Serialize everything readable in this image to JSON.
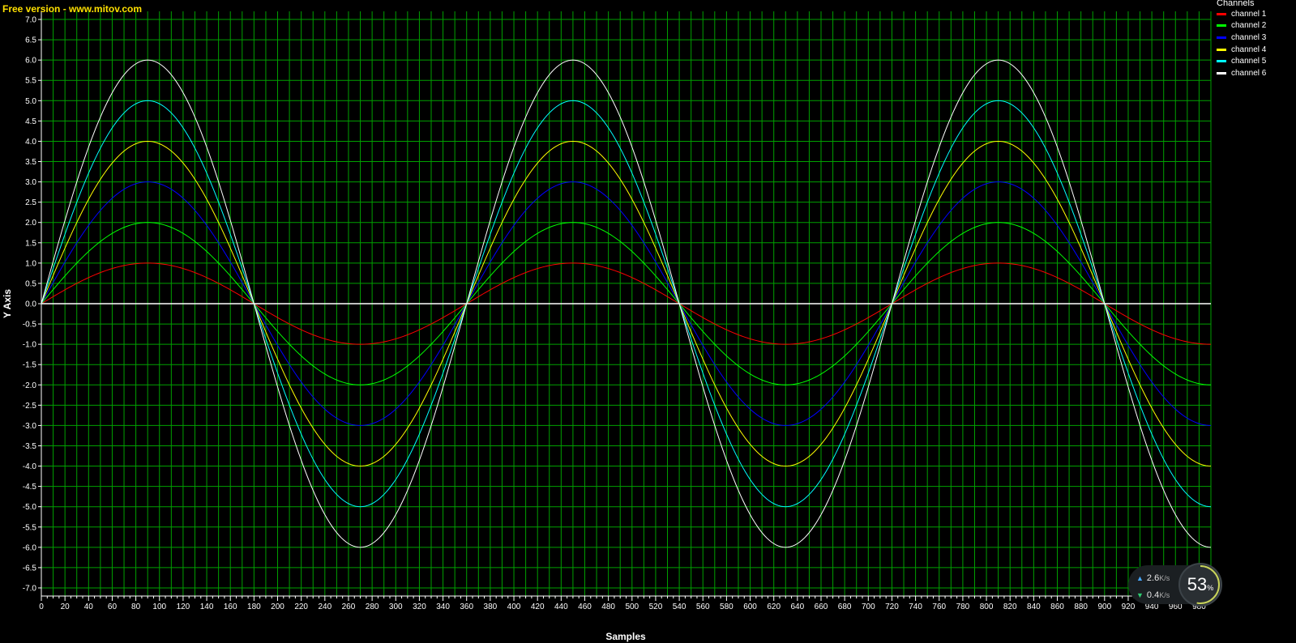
{
  "watermark": "Free version - www.mitov.com",
  "legend": {
    "title": "Channels",
    "items": [
      {
        "label": "channel 1",
        "color": "#ff0000"
      },
      {
        "label": "channel 2",
        "color": "#00ff00"
      },
      {
        "label": "channel 3",
        "color": "#0000ff"
      },
      {
        "label": "channel 4",
        "color": "#ffff00"
      },
      {
        "label": "channel 5",
        "color": "#00ffff"
      },
      {
        "label": "channel 6",
        "color": "#ffffff"
      }
    ]
  },
  "chart_data": {
    "type": "line",
    "title": "",
    "xlabel": "Samples",
    "ylabel": "Y Axis",
    "xlim": [
      0,
      990
    ],
    "ylim": [
      -7.2,
      7.2
    ],
    "x_ticks": [
      0,
      20,
      40,
      60,
      80,
      100,
      120,
      140,
      160,
      180,
      200,
      220,
      240,
      260,
      280,
      300,
      320,
      340,
      360,
      380,
      400,
      420,
      440,
      460,
      480,
      500,
      520,
      540,
      560,
      580,
      600,
      620,
      640,
      660,
      680,
      700,
      720,
      740,
      760,
      780,
      800,
      820,
      840,
      860,
      880,
      900,
      920,
      940,
      960,
      980
    ],
    "y_ticks": [
      "7.0",
      "6.5",
      "6.0",
      "5.5",
      "5.0",
      "4.5",
      "4.0",
      "3.5",
      "3.0",
      "2.5",
      "2.0",
      "1.5",
      "1.0",
      "0.5",
      "0.0",
      "-0.5",
      "-1.0",
      "-1.5",
      "-2.0",
      "-2.5",
      "-3.0",
      "-3.5",
      "-4.0",
      "-4.5",
      "-5.0",
      "-5.5",
      "-6.0",
      "-6.5",
      "-7.0"
    ],
    "grid": true,
    "background": "#000000",
    "grid_color": "#00a000",
    "legend_position": "top-right",
    "x_samples": [
      0,
      10,
      20,
      30,
      40,
      50,
      60,
      70,
      80,
      90,
      100,
      110,
      120,
      130,
      140,
      150,
      160,
      170,
      180,
      190,
      200,
      210,
      220,
      230,
      240,
      250,
      260,
      270,
      280,
      290,
      300,
      310,
      320,
      330,
      340,
      350,
      360,
      370,
      380,
      390,
      400,
      410,
      420,
      430,
      440,
      450,
      460,
      470,
      480,
      490,
      500,
      510,
      520,
      530,
      540,
      550,
      560,
      570,
      580,
      590,
      600,
      610,
      620,
      630,
      640,
      650,
      660,
      670,
      680,
      690,
      700,
      710,
      720,
      730,
      740,
      750,
      760,
      770,
      780,
      790,
      800,
      810,
      820,
      830,
      840,
      850,
      860,
      870,
      880,
      890,
      900,
      910,
      920,
      930,
      940,
      950,
      960,
      970,
      980,
      990
    ],
    "series": [
      {
        "name": "channel 1",
        "color": "#ff0000",
        "amplitude": 1,
        "values": [
          0,
          0.17,
          0.34,
          0.5,
          0.64,
          0.77,
          0.87,
          0.94,
          0.98,
          1,
          0.98,
          0.94,
          0.87,
          0.77,
          0.64,
          0.5,
          0.34,
          0.17,
          0,
          -0.17,
          -0.34,
          -0.5,
          -0.64,
          -0.77,
          -0.87,
          -0.94,
          -0.98,
          -1,
          -0.98,
          -0.94,
          -0.87,
          -0.77,
          -0.64,
          -0.5,
          -0.34,
          -0.17,
          0,
          0.17,
          0.34,
          0.5,
          0.64,
          0.77,
          0.87,
          0.94,
          0.98,
          1,
          0.98,
          0.94,
          0.87,
          0.77,
          0.64,
          0.5,
          0.34,
          0.17,
          0,
          -0.17,
          -0.34,
          -0.5,
          -0.64,
          -0.77,
          -0.87,
          -0.94,
          -0.98,
          -1,
          -0.98,
          -0.94,
          -0.87,
          -0.77,
          -0.64,
          -0.5,
          -0.34,
          -0.17,
          0,
          0.17,
          0.34,
          0.5,
          0.64,
          0.77,
          0.87,
          0.94,
          0.98,
          1,
          0.98,
          0.94,
          0.87,
          0.77,
          0.64,
          0.5,
          0.34,
          0.17,
          0,
          -0.17,
          -0.34,
          -0.5,
          -0.64,
          -0.77,
          -0.87,
          -0.94,
          -0.98,
          -1
        ]
      },
      {
        "name": "channel 2",
        "color": "#00ff00",
        "amplitude": 2,
        "values": [
          0,
          0.35,
          0.68,
          1,
          1.29,
          1.53,
          1.73,
          1.88,
          1.97,
          2,
          1.97,
          1.88,
          1.73,
          1.53,
          1.29,
          1,
          0.68,
          0.35,
          0,
          -0.35,
          -0.68,
          -1,
          -1.29,
          -1.53,
          -1.73,
          -1.88,
          -1.97,
          -2,
          -1.97,
          -1.88,
          -1.73,
          -1.53,
          -1.29,
          -1,
          -0.68,
          -0.35,
          0,
          0.35,
          0.68,
          1,
          1.29,
          1.53,
          1.73,
          1.88,
          1.97,
          2,
          1.97,
          1.88,
          1.73,
          1.53,
          1.29,
          1,
          0.68,
          0.35,
          0,
          -0.35,
          -0.68,
          -1,
          -1.29,
          -1.53,
          -1.73,
          -1.88,
          -1.97,
          -2,
          -1.97,
          -1.88,
          -1.73,
          -1.53,
          -1.29,
          -1,
          -0.68,
          -0.35,
          0,
          0.35,
          0.68,
          1,
          1.29,
          1.53,
          1.73,
          1.88,
          1.97,
          2,
          1.97,
          1.88,
          1.73,
          1.53,
          1.29,
          1,
          0.68,
          0.35,
          0,
          -0.35,
          -0.68,
          -1,
          -1.29,
          -1.53,
          -1.73,
          -1.88,
          -1.97,
          -2
        ]
      },
      {
        "name": "channel 3",
        "color": "#0000ff",
        "amplitude": 3,
        "values": [
          0,
          0.52,
          1.03,
          1.5,
          1.93,
          2.3,
          2.6,
          2.82,
          2.95,
          3,
          2.95,
          2.82,
          2.6,
          2.3,
          1.93,
          1.5,
          1.03,
          0.52,
          0,
          -0.52,
          -1.03,
          -1.5,
          -1.93,
          -2.3,
          -2.6,
          -2.82,
          -2.95,
          -3,
          -2.95,
          -2.82,
          -2.6,
          -2.3,
          -1.93,
          -1.5,
          -1.03,
          -0.52,
          0,
          0.52,
          1.03,
          1.5,
          1.93,
          2.3,
          2.6,
          2.82,
          2.95,
          3,
          2.95,
          2.82,
          2.6,
          2.3,
          1.93,
          1.5,
          1.03,
          0.52,
          0,
          -0.52,
          -1.03,
          -1.5,
          -1.93,
          -2.3,
          -2.6,
          -2.82,
          -2.95,
          -3,
          -2.95,
          -2.82,
          -2.6,
          -2.3,
          -1.93,
          -1.5,
          -1.03,
          -0.52,
          0,
          0.52,
          1.03,
          1.5,
          1.93,
          2.3,
          2.6,
          2.82,
          2.95,
          3,
          2.95,
          2.82,
          2.6,
          2.3,
          1.93,
          1.5,
          1.03,
          0.52,
          0,
          -0.52,
          -1.03,
          -1.5,
          -1.93,
          -2.3,
          -2.6,
          -2.82,
          -2.95,
          -3
        ]
      },
      {
        "name": "channel 4",
        "color": "#ffff00",
        "amplitude": 4,
        "values": [
          0,
          0.69,
          1.37,
          2,
          2.57,
          3.06,
          3.46,
          3.76,
          3.94,
          4,
          3.94,
          3.76,
          3.46,
          3.06,
          2.57,
          2,
          1.37,
          0.69,
          0,
          -0.69,
          -1.37,
          -2,
          -2.57,
          -3.06,
          -3.46,
          -3.76,
          -3.94,
          -4,
          -3.94,
          -3.76,
          -3.46,
          -3.06,
          -2.57,
          -2,
          -1.37,
          -0.69,
          0,
          0.69,
          1.37,
          2,
          2.57,
          3.06,
          3.46,
          3.76,
          3.94,
          4,
          3.94,
          3.76,
          3.46,
          3.06,
          2.57,
          2,
          1.37,
          0.69,
          0,
          -0.69,
          -1.37,
          -2,
          -2.57,
          -3.06,
          -3.46,
          -3.76,
          -3.94,
          -4,
          -3.94,
          -3.76,
          -3.46,
          -3.06,
          -2.57,
          -2,
          -1.37,
          -0.69,
          0,
          0.69,
          1.37,
          2,
          2.57,
          3.06,
          3.46,
          3.76,
          3.94,
          4,
          3.94,
          3.76,
          3.46,
          3.06,
          2.57,
          2,
          1.37,
          0.69,
          0,
          -0.69,
          -1.37,
          -2,
          -2.57,
          -3.06,
          -3.46,
          -3.76,
          -3.94,
          -4
        ]
      },
      {
        "name": "channel 5",
        "color": "#00ffff",
        "amplitude": 5,
        "values": [
          0,
          0.87,
          1.71,
          2.5,
          3.21,
          3.83,
          4.33,
          4.7,
          4.92,
          5,
          4.92,
          4.7,
          4.33,
          3.83,
          3.21,
          2.5,
          1.71,
          0.87,
          0,
          -0.87,
          -1.71,
          -2.5,
          -3.21,
          -3.83,
          -4.33,
          -4.7,
          -4.92,
          -5,
          -4.92,
          -4.7,
          -4.33,
          -3.83,
          -3.21,
          -2.5,
          -1.71,
          -0.87,
          0,
          0.87,
          1.71,
          2.5,
          3.21,
          3.83,
          4.33,
          4.7,
          4.92,
          5,
          4.92,
          4.7,
          4.33,
          3.83,
          3.21,
          2.5,
          1.71,
          0.87,
          0,
          -0.87,
          -1.71,
          -2.5,
          -3.21,
          -3.83,
          -4.33,
          -4.7,
          -4.92,
          -5,
          -4.92,
          -4.7,
          -4.33,
          -3.83,
          -3.21,
          -2.5,
          -1.71,
          -0.87,
          0,
          0.87,
          1.71,
          2.5,
          3.21,
          3.83,
          4.33,
          4.7,
          4.92,
          5,
          4.92,
          4.7,
          4.33,
          3.83,
          3.21,
          2.5,
          1.71,
          0.87,
          0,
          -0.87,
          -1.71,
          -2.5,
          -3.21,
          -3.83,
          -4.33,
          -4.7,
          -4.92,
          -5
        ]
      },
      {
        "name": "channel 6",
        "color": "#ffffff",
        "amplitude": 6,
        "values": [
          0,
          1.04,
          2.05,
          3,
          3.86,
          4.6,
          5.2,
          5.64,
          5.91,
          6,
          5.91,
          5.64,
          5.2,
          4.6,
          3.86,
          3,
          2.05,
          1.04,
          0,
          -1.04,
          -2.05,
          -3,
          -3.86,
          -4.6,
          -5.2,
          -5.64,
          -5.91,
          -6,
          -5.91,
          -5.64,
          -5.2,
          -4.6,
          -3.86,
          -3,
          -2.05,
          -1.04,
          0,
          1.04,
          2.05,
          3,
          3.86,
          4.6,
          5.2,
          5.64,
          5.91,
          6,
          5.91,
          5.64,
          5.2,
          4.6,
          3.86,
          3,
          2.05,
          1.04,
          0,
          -1.04,
          -2.05,
          -3,
          -3.86,
          -4.6,
          -5.2,
          -5.64,
          -5.91,
          -6,
          -5.91,
          -5.64,
          -5.2,
          -4.6,
          -3.86,
          -3,
          -2.05,
          -1.04,
          0,
          1.04,
          2.05,
          3,
          3.86,
          4.6,
          5.2,
          5.64,
          5.91,
          6,
          5.91,
          5.64,
          5.2,
          4.6,
          3.86,
          3,
          2.05,
          1.04,
          0,
          -1.04,
          -2.05,
          -3,
          -3.86,
          -4.6,
          -5.2,
          -5.64,
          -5.91,
          -6
        ]
      }
    ]
  },
  "network_widget": {
    "upload_value": "2.6",
    "upload_unit": "K/s",
    "download_value": "0.4",
    "download_unit": "K/s",
    "percent": "53",
    "percent_sign": "%",
    "percent_fraction": 0.53
  }
}
